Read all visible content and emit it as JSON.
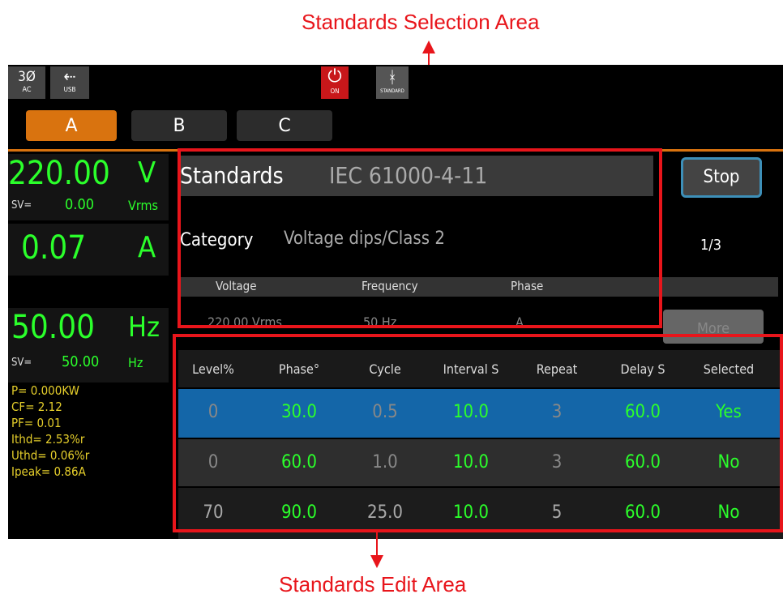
{
  "callouts": {
    "top": "Standards Selection Area",
    "bottom": "Standards Edit Area"
  },
  "status_bar": {
    "phase_label": "3Ø",
    "phase_sub": "AC",
    "usb_sub": "USB",
    "power_sub": "ON",
    "standard_sub": "STANDARD"
  },
  "tabs": [
    "A",
    "B",
    "C"
  ],
  "meters": {
    "voltage_value": "220.00",
    "voltage_unit": "V",
    "voltage_sv_label": "SV=",
    "voltage_sv_value": "0.00",
    "voltage_sv_unit": "Vrms",
    "current_value": "0.07",
    "current_unit": "A",
    "freq_value": "50.00",
    "freq_unit": "Hz",
    "freq_sv_label": "SV=",
    "freq_sv_value": "50.00",
    "freq_sv_unit": "Hz",
    "readings": [
      "P= 0.000KW",
      "CF= 2.12",
      "PF= 0.01",
      "Ithd= 2.53%r",
      "Uthd= 0.06%r",
      "Ipeak= 0.86A"
    ]
  },
  "standards": {
    "label": "Standards",
    "value": "IEC 61000-4-11",
    "category_label": "Category",
    "category_value": "Voltage dips/Class 2",
    "stop_button": "Stop",
    "page": "1/3",
    "more_button": "More",
    "param_headers": [
      "Voltage",
      "Frequency",
      "Phase"
    ],
    "param_values": [
      "220.00 Vrms",
      "50 Hz",
      "A"
    ]
  },
  "table": {
    "headers": [
      "Level%",
      "Phase°",
      "Cycle",
      "Interval S",
      "Repeat",
      "Delay S",
      "Selected"
    ],
    "rows": [
      [
        "0",
        "30.0",
        "0.5",
        "10.0",
        "3",
        "60.0",
        "Yes"
      ],
      [
        "0",
        "60.0",
        "1.0",
        "10.0",
        "3",
        "60.0",
        "No"
      ],
      [
        "70",
        "90.0",
        "25.0",
        "10.0",
        "5",
        "60.0",
        "No"
      ]
    ]
  },
  "colors": {
    "accent_tab": "#d9730f",
    "selected_row": "#1466a8",
    "value_green": "#2bff2b",
    "annotation_red": "#e8151b"
  }
}
